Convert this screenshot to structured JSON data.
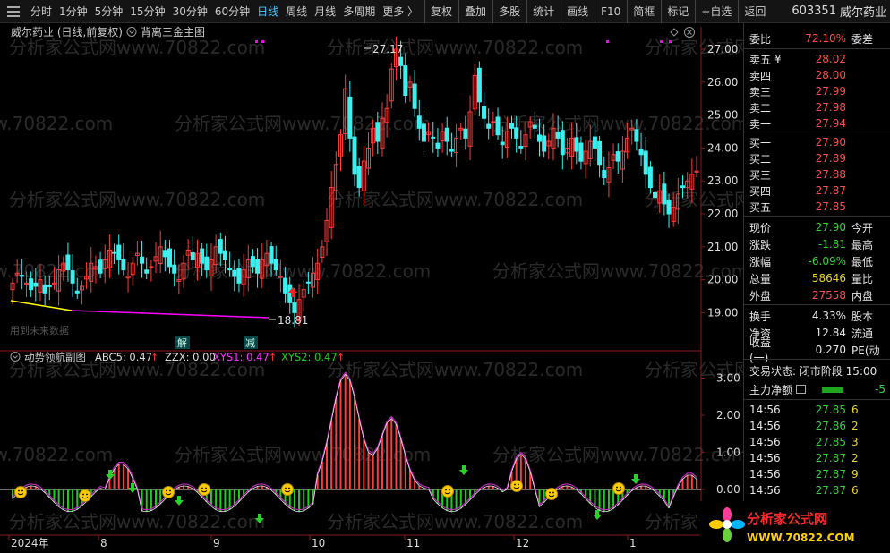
{
  "toolbar": {
    "left_items": [
      "分时",
      "1分钟",
      "5分钟",
      "15分钟",
      "30分钟",
      "60分钟",
      "日线",
      "周线",
      "月线",
      "多周期",
      "更多 〉"
    ],
    "active": "日线",
    "right_items": [
      "复权",
      "叠加",
      "多股",
      "统计",
      "画线",
      "F10",
      "简框",
      "标记",
      "+自选",
      "返回"
    ],
    "stock_code": "603351",
    "stock_name": "威尔药业"
  },
  "main": {
    "title": "威尔药业 (日线,前复权)",
    "indicator_name": "背离三金主图",
    "y_ticks": [
      "27.00",
      "26.00",
      "25.00",
      "24.00",
      "23.00",
      "22.00",
      "21.00",
      "20.00",
      "19.00"
    ],
    "high_label": "27.17",
    "low_label": "18.81",
    "watermark": "分析家公式网www.70822.com",
    "future_data": "用到未来数据",
    "tag_jie": "解",
    "tag_jian": "减"
  },
  "sub": {
    "name": "动势领航副图",
    "abc5_label": "ABC5: 0.47",
    "zzx_label": "ZZX: 0.00",
    "xys1_label": "XYS1: 0.47",
    "xys2_label": "XYS2: 0.47",
    "y_ticks": [
      "3.00",
      "2.00",
      "1.00",
      "0.00"
    ]
  },
  "x_axis": [
    "2024年",
    "8",
    "9",
    "10",
    "11",
    "12",
    "1"
  ],
  "colors": {
    "up": "#ff3b3b",
    "down": "#3cf0f0",
    "green": "#19d119",
    "magenta": "#ff00ff",
    "yellow": "#ffff00",
    "toolbar_active": "#4cc6ff"
  },
  "quote": {
    "weibi_label": "委比",
    "weibi_val": "72.10%",
    "weicha_label": "委差",
    "sell": [
      {
        "label": "卖五",
        "val": "28.02"
      },
      {
        "label": "卖四",
        "val": "28.00"
      },
      {
        "label": "卖三",
        "val": "27.99"
      },
      {
        "label": "卖二",
        "val": "27.98"
      },
      {
        "label": "卖一",
        "val": "27.94"
      }
    ],
    "buy": [
      {
        "label": "买一",
        "val": "27.90"
      },
      {
        "label": "买二",
        "val": "27.89"
      },
      {
        "label": "买三",
        "val": "27.88"
      },
      {
        "label": "买四",
        "val": "27.87"
      },
      {
        "label": "买五",
        "val": "27.85"
      }
    ],
    "sell5_mark": "¥",
    "stats": [
      {
        "label": "现价",
        "val": "27.90",
        "label2": "今开",
        "color": "green"
      },
      {
        "label": "涨跌",
        "val": "-1.81",
        "label2": "最高",
        "color": "green"
      },
      {
        "label": "涨幅",
        "val": "-6.09%",
        "label2": "最低",
        "color": "green"
      },
      {
        "label": "总量",
        "val": "58646",
        "label2": "量比",
        "color": "yellow"
      },
      {
        "label": "外盘",
        "val": "27558",
        "label2": "内盘",
        "color": "red"
      }
    ],
    "stats2": [
      {
        "label": "换手",
        "val": "4.33%",
        "label2": "股本"
      },
      {
        "label": "净资",
        "val": "12.84",
        "label2": "流通"
      },
      {
        "label": "收益(一)",
        "val": "0.270",
        "label2": "PE(动"
      }
    ],
    "trade_status": "交易状态: 闭市阶段 15:00",
    "main_net": "主力净额",
    "main_net_val": "-5",
    "ticks": [
      {
        "time": "14:56",
        "price": "27.85",
        "vol": "6"
      },
      {
        "time": "14:56",
        "price": "27.86",
        "vol": "2"
      },
      {
        "time": "14:56",
        "price": "27.85",
        "vol": "3"
      },
      {
        "time": "14:56",
        "price": "27.87",
        "vol": "2"
      },
      {
        "time": "14:56",
        "price": "27.87",
        "vol": "9"
      },
      {
        "time": "14:56",
        "price": "27.87",
        "vol": "6"
      }
    ]
  },
  "logo": {
    "line1": "分析家公式网",
    "line2": "WWW.70822.COM"
  }
}
